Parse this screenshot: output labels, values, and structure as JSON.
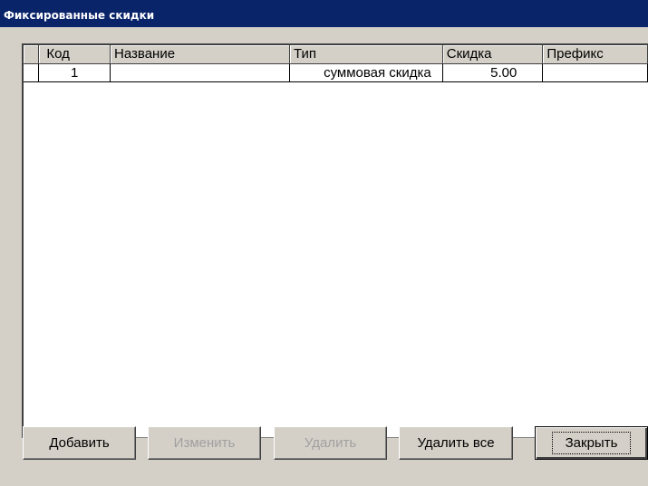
{
  "window": {
    "title": "Фиксированные скидки"
  },
  "table": {
    "columns": [
      "Код",
      "Название",
      "Тип",
      "Скидка",
      "Префикс"
    ],
    "rows": [
      {
        "code": "1",
        "name": "",
        "type": "суммовая скидка",
        "discount": "5.00",
        "prefix": ""
      }
    ]
  },
  "buttons": {
    "add": "Добавить",
    "edit": "Изменить",
    "delete": "Удалить",
    "delete_all": "Удалить все",
    "close": "Закрыть"
  },
  "colors": {
    "titlebar": "#0a246a",
    "face": "#d4d0c8"
  }
}
